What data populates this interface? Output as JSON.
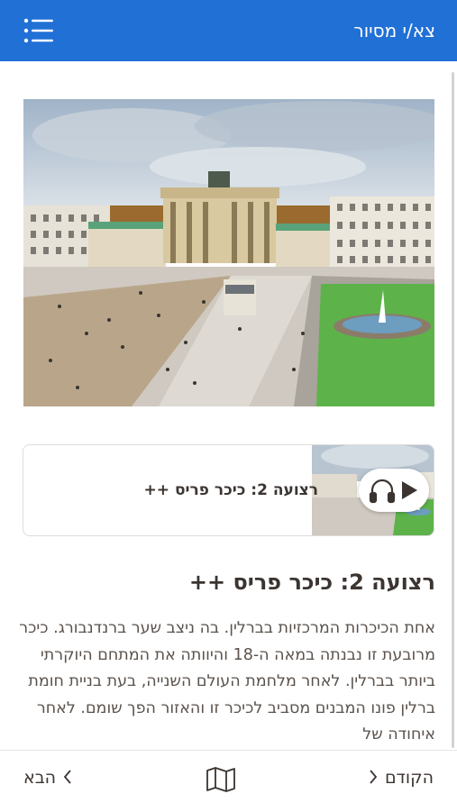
{
  "header": {
    "title": "צא/י מסיור",
    "menu_icon": "hamburger-menu-icon",
    "background": "#2170d6"
  },
  "audio_card": {
    "title": "רצועה 2: כיכר פריס ++",
    "headphones_icon": "headphones-icon",
    "play_icon": "play-icon"
  },
  "content": {
    "title": "רצועה 2: כיכר פריס ++",
    "body": "אחת הכיכרות המרכזיות בברלין. בה ניצב שער ברנדנבורג. כיכר מרובעת זו נבנתה במאה ה-18 והיוותה את המתחם היוקרתי ביותר בברלין. לאחר מלחמת העולם השנייה, בעת בניית חומת ברלין פונו המבנים מסביב לכיכר זו והאזור הפך שומם. לאחר איחודה של"
  },
  "bottom_nav": {
    "next_label": "הבא",
    "prev_label": "הקודם",
    "map_icon": "map-icon"
  }
}
